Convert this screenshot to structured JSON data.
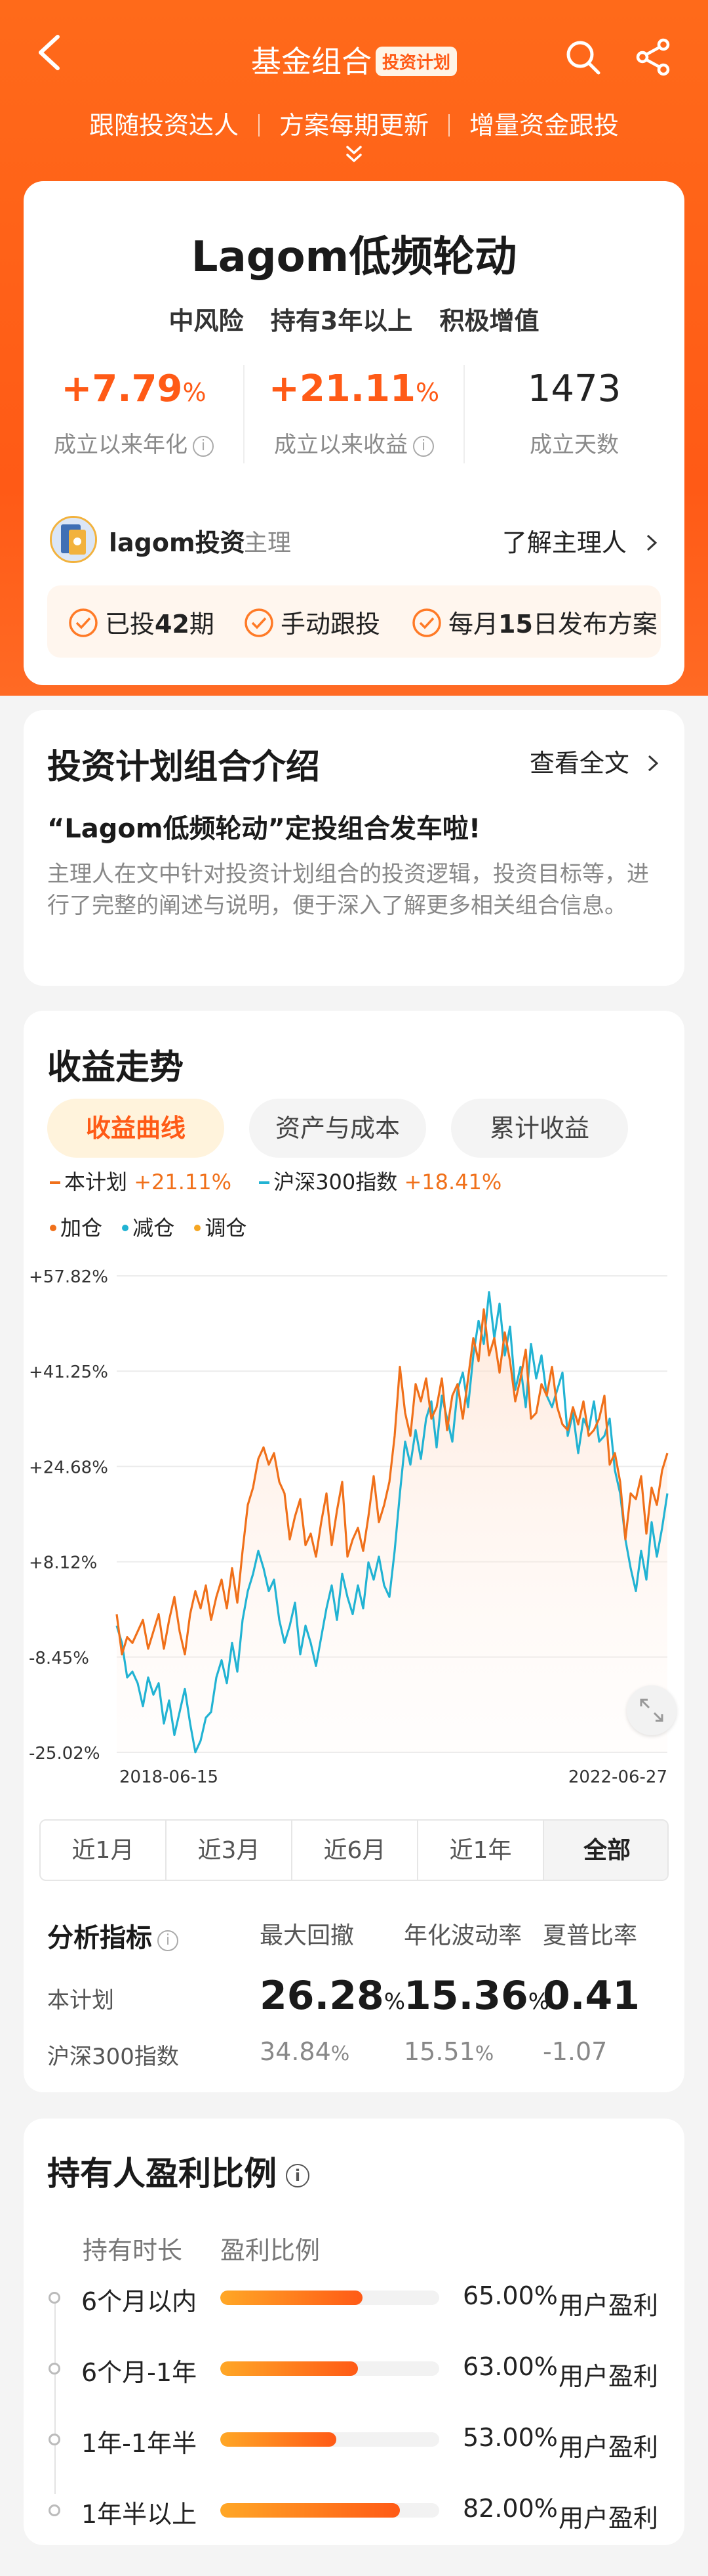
{
  "header": {
    "title": "基金组合",
    "tag": "投资计划",
    "slogans": [
      "跟随投资达人",
      "方案每期更新",
      "增量资金跟投"
    ]
  },
  "fund": {
    "name": "Lagom低频轮动",
    "tags": [
      "中风险",
      "持有3年以上",
      "积极增值"
    ],
    "metrics": [
      {
        "value": "+7.79",
        "unit": "%",
        "label": "成立以来年化"
      },
      {
        "value": "+21.11",
        "unit": "%",
        "label": "成立以来收益"
      },
      {
        "value": "1473",
        "unit": "",
        "label": "成立天数"
      }
    ],
    "manager": {
      "name": "lagom投资",
      "role": "主理",
      "link": "了解主理人"
    },
    "badges": [
      {
        "pre": "已投",
        "strong": "42",
        "post": "期"
      },
      {
        "pre": "手动跟投",
        "strong": "",
        "post": ""
      },
      {
        "pre": "每月",
        "strong": "15",
        "post": "日发布方案"
      }
    ]
  },
  "intro": {
    "title": "投资计划组合介绍",
    "more": "查看全文",
    "headline": "“Lagom低频轮动”定投组合发车啦!",
    "body": "主理人在文中针对投资计划组合的投资逻辑，投资目标等，进行了完整的阐述与说明，便于深入了解更多相关组合信息。"
  },
  "trend": {
    "title": "收益走势",
    "tabs": [
      "收益曲线",
      "资产与成本",
      "累计收益"
    ],
    "legend": [
      {
        "name": "本计划",
        "value": "+21.11%"
      },
      {
        "name": "沪深300指数",
        "value": "+18.41%"
      }
    ],
    "marks": [
      "加仓",
      "减仓",
      "调仓"
    ],
    "ranges": [
      "近1月",
      "近3月",
      "近6月",
      "近1年",
      "全部"
    ]
  },
  "colors": {
    "brand": "#ff5a16",
    "plan_line": "#f0701a",
    "index_line": "#22b3d3",
    "buy": "#f0701a",
    "sell": "#22b3d3",
    "adjust": "#f5a623"
  },
  "chart_data": {
    "type": "line",
    "title": "",
    "xlabel": "",
    "ylabel": "",
    "x_labels": [
      "2018-06-15",
      "2022-06-27"
    ],
    "y_ticks": [
      "+57.82%",
      "+41.25%",
      "+24.68%",
      "+8.12%",
      "-8.45%",
      "-25.02%"
    ],
    "ylim": [
      -25.02,
      57.82
    ],
    "grid": true,
    "series": [
      {
        "name": "本计划",
        "values": [
          -1,
          -8,
          -5,
          -6,
          -4,
          -2,
          -7,
          -4,
          -1,
          -7,
          -2,
          2,
          -4,
          -8,
          -1,
          3,
          0,
          4,
          -2,
          2,
          5,
          0,
          7,
          1,
          10,
          18,
          21,
          26,
          28,
          25,
          27,
          22,
          20,
          12,
          16,
          19,
          11,
          13,
          9,
          15,
          20,
          11,
          17,
          22,
          9,
          12,
          14,
          10,
          16,
          23,
          15,
          18,
          22,
          30,
          42,
          34,
          30,
          39,
          36,
          40,
          33,
          35,
          40,
          31,
          37,
          39,
          33,
          40,
          47,
          43,
          52,
          44,
          47,
          41,
          48,
          43,
          36,
          40,
          45,
          33,
          34,
          39,
          37,
          42,
          35,
          32,
          31,
          35,
          32,
          36,
          30,
          31,
          33,
          37,
          25,
          27,
          22,
          12,
          20,
          19,
          23,
          13,
          21,
          18,
          24,
          27
        ]
      },
      {
        "name": "沪深300指数",
        "values": [
          -3,
          -6,
          -12,
          -11,
          -13,
          -17,
          -12,
          -15,
          -13,
          -20,
          -16,
          -22,
          -18,
          -14,
          -20,
          -25,
          -23,
          -19,
          -18,
          -12,
          -9,
          -13,
          -6,
          -11,
          -2,
          3,
          6,
          10,
          7,
          3,
          5,
          -2,
          -6,
          -3,
          1,
          -8,
          -3,
          -6,
          -10,
          -5,
          0,
          4,
          -2,
          6,
          2,
          -1,
          4,
          0,
          8,
          5,
          9,
          4,
          2,
          10,
          20,
          29,
          25,
          31,
          26,
          33,
          36,
          28,
          37,
          33,
          29,
          38,
          41,
          35,
          44,
          50,
          46,
          55,
          47,
          53,
          44,
          49,
          38,
          42,
          35,
          46,
          40,
          44,
          37,
          35,
          38,
          41,
          30,
          34,
          27,
          33,
          31,
          36,
          29,
          30,
          33,
          24,
          20,
          12,
          7,
          3,
          10,
          5,
          15,
          9,
          14,
          20
        ]
      }
    ]
  },
  "analysis": {
    "title": "分析指标",
    "headers": [
      "最大回撤",
      "年化波动率",
      "夏普比率"
    ],
    "rows": [
      {
        "name": "本计划",
        "values": [
          "26.28",
          "15.36",
          "0.41"
        ],
        "units": [
          "%",
          "%",
          ""
        ]
      },
      {
        "name": "沪深300指数",
        "values": [
          "34.84",
          "15.51",
          "-1.07"
        ],
        "units": [
          "%",
          "%",
          ""
        ]
      }
    ]
  },
  "profit": {
    "title": "持有人盈利比例",
    "col_headers": [
      "持有时长",
      "盈利比例"
    ],
    "suffix": "用户盈利",
    "rows": [
      {
        "period": "6个月以内",
        "pct": "65.00%",
        "ratio": 0.65
      },
      {
        "period": "6个月-1年",
        "pct": "63.00%",
        "ratio": 0.63
      },
      {
        "period": "1年-1年半",
        "pct": "53.00%",
        "ratio": 0.53
      },
      {
        "period": "1年半以上",
        "pct": "82.00%",
        "ratio": 0.82
      }
    ]
  }
}
